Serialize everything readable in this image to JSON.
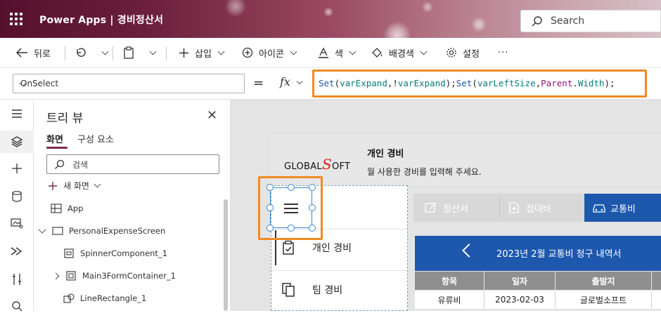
{
  "titlebar": {
    "app_title": "Power Apps  |  경비정산서",
    "search_placeholder": "Search"
  },
  "commands": {
    "back": "뒤로",
    "insert": "삽입",
    "icon": "아이콘",
    "color": "색",
    "background": "배경색",
    "settings": "설정",
    "more": "···"
  },
  "formula_bar": {
    "property": "OnSelect",
    "equals": "=",
    "fx": "fx",
    "formula_parts": [
      {
        "text": "Set",
        "cls": "kw"
      },
      {
        "text": "(",
        "cls": "pl"
      },
      {
        "text": "varExpand",
        "cls": "vr"
      },
      {
        "text": ",!",
        "cls": "pl"
      },
      {
        "text": "varExpand",
        "cls": "vr"
      },
      {
        "text": ");",
        "cls": "pl"
      },
      {
        "text": "Set",
        "cls": "kw"
      },
      {
        "text": "(",
        "cls": "pl"
      },
      {
        "text": "varLeftSize",
        "cls": "vr"
      },
      {
        "text": ",",
        "cls": "pl"
      },
      {
        "text": "Parent",
        "cls": "pr"
      },
      {
        "text": ".",
        "cls": "pl"
      },
      {
        "text": "Width",
        "cls": "vr"
      },
      {
        "text": ");",
        "cls": "pl"
      }
    ]
  },
  "tree": {
    "title": "트리 뷰",
    "close": "✕",
    "tabs": [
      "화면",
      "구성 요소"
    ],
    "search_placeholder": "검색",
    "new_screen": "새 화면",
    "nodes": [
      "App",
      "PersonalExpenseScreen",
      "SpinnerComponent_1",
      "Main3FormContainer_1",
      "LineRectangle_1"
    ]
  },
  "app_canvas": {
    "logo_text_a": "GLOBAL",
    "logo_text_b": "S",
    "logo_text_c": "OFT",
    "header_title": "개인 경비",
    "header_subtitle": "월 사용한 경비를 입력해 주세요.",
    "menu_items": [
      "개인 경비",
      "팀 경비"
    ],
    "tabs": [
      "정산서",
      "접대비",
      "교통비"
    ],
    "list_title": "2023년  2월 교통비 청구 내역서",
    "table_headers": [
      "항목",
      "일자",
      "출발지"
    ],
    "table_row": [
      "유류비",
      "2023-02-03",
      "글로벌소프트"
    ]
  },
  "colors": {
    "accent_orange": "#f08a24",
    "brand_blue": "#1e58ad",
    "titlebar_start": "#55102d"
  }
}
